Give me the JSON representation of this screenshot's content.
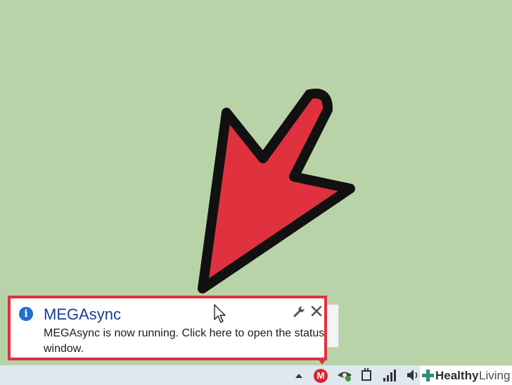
{
  "notification": {
    "title": "MEGAsync",
    "message": "MEGAsync is now running. Click here to open the status window.",
    "info_icon": "info-icon",
    "settings_icon": "wrench-icon",
    "close_icon": "close-icon"
  },
  "tray": {
    "mega_glyph": "M",
    "icons": [
      "chevron-up-icon",
      "mega-icon",
      "eye-icon",
      "usb-icon",
      "signal-icon",
      "speaker-icon"
    ]
  },
  "watermark": {
    "brand_bold": "Healthy",
    "brand_light": "Living"
  },
  "colors": {
    "desktop": "#b9d3a8",
    "arrow": "#e0313f",
    "balloon_border": "#e0313f",
    "title": "#1a3d9a",
    "mega_red": "#d9272e"
  }
}
